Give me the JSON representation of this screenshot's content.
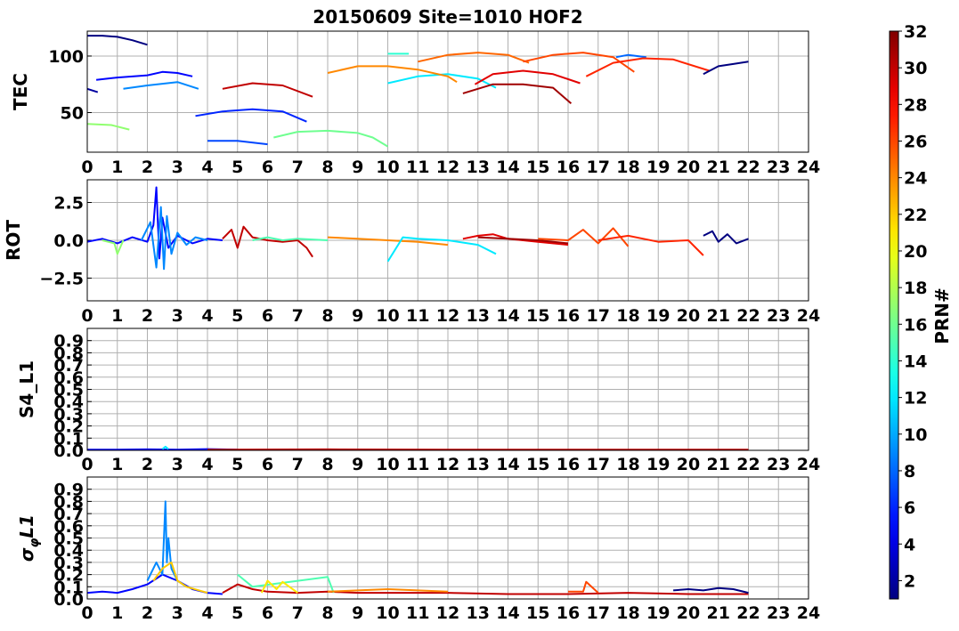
{
  "title": "20150609 Site=1010 HOF2",
  "colorbar": {
    "label": "PRN#",
    "range": [
      1,
      32
    ],
    "ticks": [
      "2",
      "4",
      "6",
      "8",
      "10",
      "12",
      "14",
      "16",
      "18",
      "20",
      "22",
      "24",
      "26",
      "28",
      "30",
      "32"
    ],
    "colormap": "jet"
  },
  "chart_data": [
    {
      "type": "line",
      "ylabel": "TEC",
      "xlim": [
        0,
        24
      ],
      "ylim": [
        15,
        122
      ],
      "xticks": [
        "0",
        "1",
        "2",
        "3",
        "4",
        "5",
        "6",
        "7",
        "8",
        "9",
        "10",
        "11",
        "12",
        "13",
        "14",
        "15",
        "16",
        "17",
        "18",
        "19",
        "20",
        "21",
        "22",
        "23",
        "24"
      ],
      "yticks": [
        {
          "v": 50,
          "t": "50"
        },
        {
          "v": 100,
          "t": "100"
        }
      ],
      "series": [
        {
          "prn": 1,
          "x": [
            0,
            0.5,
            1,
            1.5,
            2
          ],
          "y": [
            118,
            118,
            117,
            114,
            110
          ]
        },
        {
          "prn": 2,
          "x": [
            0,
            0.35
          ],
          "y": [
            71,
            68
          ]
        },
        {
          "prn": 5,
          "x": [
            0.3,
            1,
            2,
            2.5,
            3,
            3.5
          ],
          "y": [
            79,
            81,
            83,
            86,
            85,
            82
          ]
        },
        {
          "prn": 6,
          "x": [
            3.6,
            4.5,
            5.5,
            6.5,
            7.3
          ],
          "y": [
            47,
            51,
            53,
            51,
            42
          ]
        },
        {
          "prn": 7,
          "x": [
            4,
            5,
            6
          ],
          "y": [
            25,
            25,
            22
          ]
        },
        {
          "prn": 8,
          "x": [
            17.6,
            18,
            18.6
          ],
          "y": [
            99,
            101,
            99
          ]
        },
        {
          "prn": 9,
          "x": [
            1.2,
            2,
            3,
            3.7
          ],
          "y": [
            71,
            74,
            77,
            71
          ]
        },
        {
          "prn": 12,
          "x": [
            10,
            11,
            12,
            13,
            13.6
          ],
          "y": [
            76,
            82,
            84,
            80,
            72
          ]
        },
        {
          "prn": 14,
          "x": [
            10,
            10.7
          ],
          "y": [
            102,
            102
          ]
        },
        {
          "prn": 17,
          "x": [
            0,
            0.8,
            1.4
          ],
          "y": [
            40,
            39,
            35
          ]
        },
        {
          "prn": 16,
          "x": [
            6.2,
            7,
            8,
            9,
            9.5,
            10
          ],
          "y": [
            28,
            33,
            34,
            32,
            28,
            20
          ]
        },
        {
          "prn": 24,
          "x": [
            8,
            9,
            10,
            11,
            12,
            12.3
          ],
          "y": [
            85,
            91,
            91,
            88,
            82,
            77
          ]
        },
        {
          "prn": 25,
          "x": [
            11,
            12,
            13,
            14,
            14.7
          ],
          "y": [
            95,
            101,
            103,
            101,
            94
          ]
        },
        {
          "prn": 26,
          "x": [
            14.5,
            15.5,
            16.5,
            17.5,
            18.2
          ],
          "y": [
            95,
            101,
            103,
            99,
            86
          ]
        },
        {
          "prn": 27,
          "x": [
            16.6,
            17.5,
            18.5,
            19.5,
            20.7
          ],
          "y": [
            82,
            94,
            98,
            97,
            87
          ]
        },
        {
          "prn": 29,
          "x": [
            12.9,
            13.5,
            14.5,
            15.5,
            16.4
          ],
          "y": [
            75,
            84,
            87,
            84,
            76
          ]
        },
        {
          "prn": 30,
          "x": [
            4.5,
            5.5,
            6.5,
            7.5
          ],
          "y": [
            71,
            76,
            74,
            64
          ]
        },
        {
          "prn": 31,
          "x": [
            12.5,
            13.5,
            14.5,
            15.5,
            16.1
          ],
          "y": [
            67,
            75,
            75,
            72,
            58
          ]
        },
        {
          "prn": 1,
          "x": [
            20.5,
            21,
            21.5,
            22
          ],
          "y": [
            84,
            91,
            93,
            95
          ]
        }
      ]
    },
    {
      "type": "line",
      "ylabel": "ROT",
      "xlim": [
        0,
        24
      ],
      "ylim": [
        -4,
        4
      ],
      "xticks": [
        "0",
        "1",
        "2",
        "3",
        "4",
        "5",
        "6",
        "7",
        "8",
        "9",
        "10",
        "11",
        "12",
        "13",
        "14",
        "15",
        "16",
        "17",
        "18",
        "19",
        "20",
        "21",
        "22",
        "23",
        "24"
      ],
      "yticks": [
        {
          "v": 2.5,
          "t": "2.5"
        },
        {
          "v": 0,
          "t": "0.0"
        },
        {
          "v": -2.5,
          "t": "−2.5"
        }
      ],
      "series": [
        {
          "prn": 5,
          "x": [
            0,
            0.5,
            1,
            1.5,
            2,
            2.2,
            2.3,
            2.4,
            2.5,
            2.7,
            3,
            3.5,
            4,
            4.5
          ],
          "y": [
            -0.1,
            0.1,
            -0.2,
            0.2,
            -0.1,
            1.0,
            3.5,
            -1.2,
            1.5,
            -0.5,
            0.3,
            -0.2,
            0.1,
            0
          ]
        },
        {
          "prn": 9,
          "x": [
            1.8,
            2.1,
            2.3,
            2.45,
            2.55,
            2.65,
            2.8,
            3.0,
            3.3,
            3.6,
            4.0
          ],
          "y": [
            0,
            1.2,
            -1.8,
            2.2,
            -1.9,
            1.6,
            -0.9,
            0.5,
            -0.3,
            0.2,
            0
          ]
        },
        {
          "prn": 17,
          "x": [
            0.5,
            0.9,
            1.0,
            1.2
          ],
          "y": [
            0,
            -0.2,
            -0.9,
            0
          ]
        },
        {
          "prn": 30,
          "x": [
            4.5,
            4.8,
            5.0,
            5.2,
            5.5,
            6.0,
            6.5,
            7.0,
            7.3,
            7.5
          ],
          "y": [
            0.1,
            0.7,
            -0.5,
            0.9,
            0.2,
            0,
            -0.1,
            0,
            -0.5,
            -1.1
          ]
        },
        {
          "prn": 15,
          "x": [
            5.5,
            6.0,
            6.5,
            7.0,
            8.0
          ],
          "y": [
            0,
            0.2,
            0,
            0.1,
            0
          ]
        },
        {
          "prn": 24,
          "x": [
            8,
            9,
            10,
            11,
            12
          ],
          "y": [
            0.2,
            0.1,
            0,
            -0.1,
            -0.3
          ]
        },
        {
          "prn": 12,
          "x": [
            10,
            10.5,
            11,
            12,
            13,
            13.6
          ],
          "y": [
            -1.4,
            0.2,
            0.1,
            0,
            -0.3,
            -0.9
          ]
        },
        {
          "prn": 29,
          "x": [
            12.5,
            13,
            13.5,
            14,
            15,
            16
          ],
          "y": [
            0.1,
            0.3,
            0.4,
            0.1,
            -0.1,
            -0.3
          ]
        },
        {
          "prn": 31,
          "x": [
            13,
            14,
            15,
            16
          ],
          "y": [
            0.2,
            0.1,
            0,
            -0.2
          ]
        },
        {
          "prn": 26,
          "x": [
            15,
            16,
            16.5,
            17,
            17.5,
            18
          ],
          "y": [
            0.1,
            0,
            0.7,
            -0.2,
            0.8,
            -0.4
          ]
        },
        {
          "prn": 27,
          "x": [
            17,
            18,
            19,
            20,
            20.5
          ],
          "y": [
            0,
            0.3,
            -0.1,
            0,
            -1.0
          ]
        },
        {
          "prn": 1,
          "x": [
            20.5,
            20.8,
            21,
            21.3,
            21.6,
            22
          ],
          "y": [
            0.3,
            0.6,
            -0.1,
            0.4,
            -0.2,
            0.1
          ]
        }
      ]
    },
    {
      "type": "line",
      "ylabel": "S4_L1",
      "xlim": [
        0,
        24
      ],
      "ylim": [
        0,
        1
      ],
      "xticks": [
        "0",
        "1",
        "2",
        "3",
        "4",
        "5",
        "6",
        "7",
        "8",
        "9",
        "10",
        "11",
        "12",
        "13",
        "14",
        "15",
        "16",
        "17",
        "18",
        "19",
        "20",
        "21",
        "22",
        "23",
        "24"
      ],
      "yticks": [
        {
          "v": 0,
          "t": "0.0"
        },
        {
          "v": 0.1,
          "t": "0.1"
        },
        {
          "v": 0.2,
          "t": "0.2"
        },
        {
          "v": 0.3,
          "t": "0.3"
        },
        {
          "v": 0.4,
          "t": "0.4"
        },
        {
          "v": 0.5,
          "t": "0.5"
        },
        {
          "v": 0.6,
          "t": "0.6"
        },
        {
          "v": 0.7,
          "t": "0.7"
        },
        {
          "v": 0.8,
          "t": "0.8"
        },
        {
          "v": 0.9,
          "t": "0.9"
        }
      ],
      "series": [
        {
          "prn": 5,
          "x": [
            0,
            1,
            2,
            3,
            4,
            5
          ],
          "y": [
            0.005,
            0.005,
            0.008,
            0.005,
            0.01,
            0.005
          ]
        },
        {
          "prn": 12,
          "x": [
            2.5,
            2.6,
            2.7
          ],
          "y": [
            0.01,
            0.03,
            0.01
          ]
        },
        {
          "prn": 30,
          "x": [
            4,
            8,
            12,
            16,
            20,
            22
          ],
          "y": [
            0.005,
            0.008,
            0.005,
            0.006,
            0.005,
            0.005
          ]
        }
      ]
    },
    {
      "type": "line",
      "ylabel": "σ<sub>φ</sub>L1",
      "xlim": [
        0,
        24
      ],
      "ylim": [
        0,
        1
      ],
      "xticks": [
        "0",
        "1",
        "2",
        "3",
        "4",
        "5",
        "6",
        "7",
        "8",
        "9",
        "10",
        "11",
        "12",
        "13",
        "14",
        "15",
        "16",
        "17",
        "18",
        "19",
        "20",
        "21",
        "22",
        "23",
        "24"
      ],
      "yticks": [
        {
          "v": 0,
          "t": "0.0"
        },
        {
          "v": 0.1,
          "t": "0.1"
        },
        {
          "v": 0.2,
          "t": "0.2"
        },
        {
          "v": 0.3,
          "t": "0.3"
        },
        {
          "v": 0.4,
          "t": "0.4"
        },
        {
          "v": 0.5,
          "t": "0.5"
        },
        {
          "v": 0.6,
          "t": "0.6"
        },
        {
          "v": 0.7,
          "t": "0.7"
        },
        {
          "v": 0.8,
          "t": "0.8"
        },
        {
          "v": 0.9,
          "t": "0.9"
        }
      ],
      "series": [
        {
          "prn": 5,
          "x": [
            0,
            0.5,
            1,
            1.5,
            2,
            2.5,
            3,
            3.5,
            4,
            4.5
          ],
          "y": [
            0.05,
            0.06,
            0.05,
            0.08,
            0.12,
            0.2,
            0.15,
            0.08,
            0.05,
            0.04
          ]
        },
        {
          "prn": 9,
          "x": [
            2,
            2.3,
            2.5,
            2.6,
            2.65,
            2.7,
            2.8,
            3.0,
            3.3
          ],
          "y": [
            0.15,
            0.3,
            0.2,
            0.8,
            0.3,
            0.5,
            0.25,
            0.15,
            0.1
          ]
        },
        {
          "prn": 22,
          "x": [
            2.2,
            2.5,
            2.8,
            3.0,
            3.3,
            4.0
          ],
          "y": [
            0.15,
            0.25,
            0.3,
            0.15,
            0.1,
            0.05
          ]
        },
        {
          "prn": 30,
          "x": [
            4.5,
            5,
            5.5,
            6,
            7,
            8,
            9,
            10,
            12,
            14,
            16,
            18,
            20,
            22
          ],
          "y": [
            0.05,
            0.12,
            0.08,
            0.06,
            0.05,
            0.06,
            0.05,
            0.05,
            0.05,
            0.04,
            0.04,
            0.05,
            0.04,
            0.04
          ]
        },
        {
          "prn": 15,
          "x": [
            5,
            5.5,
            8,
            8.2
          ],
          "y": [
            0.2,
            0.1,
            0.18,
            0.05
          ]
        },
        {
          "prn": 21,
          "x": [
            5.8,
            6,
            6.3,
            6.5,
            7
          ],
          "y": [
            0.05,
            0.15,
            0.08,
            0.14,
            0.05
          ]
        },
        {
          "prn": 24,
          "x": [
            8,
            9,
            10,
            11,
            12
          ],
          "y": [
            0.06,
            0.07,
            0.08,
            0.07,
            0.06
          ]
        },
        {
          "prn": 26,
          "x": [
            16,
            16.5,
            16.6,
            17
          ],
          "y": [
            0.06,
            0.06,
            0.14,
            0.05
          ]
        },
        {
          "prn": 1,
          "x": [
            19.5,
            20,
            20.5,
            21,
            21.5,
            22
          ],
          "y": [
            0.07,
            0.08,
            0.07,
            0.09,
            0.08,
            0.05
          ]
        }
      ]
    }
  ]
}
